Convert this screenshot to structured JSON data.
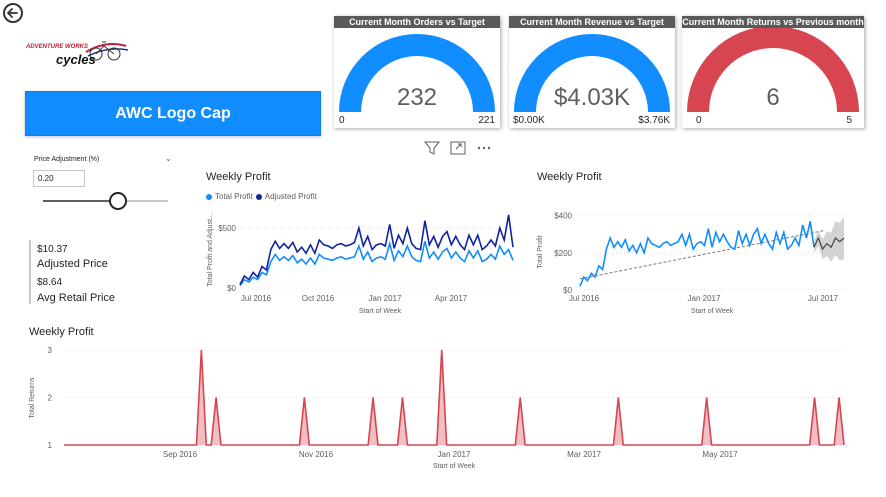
{
  "report": {
    "logo_text_top": "ADVENTURE WORKS",
    "logo_text_bottom": "cycles",
    "title_button": "AWC Logo Cap"
  },
  "gauges": [
    {
      "title": "Current Month Orders vs Target",
      "value": "232",
      "min": "0",
      "max": "221",
      "fraction": 1.0,
      "color": "#118DFF"
    },
    {
      "title": "Current Month Revenue vs Target",
      "value": "$4.03K",
      "min": "$0.00K",
      "max": "$3.76K",
      "fraction": 1.0,
      "color": "#118DFF"
    },
    {
      "title": "Current Month Returns vs Previous month",
      "value": "6",
      "min": "0",
      "max": "5",
      "fraction": 1.0,
      "color": "#D64550"
    }
  ],
  "slicer": {
    "label": "Price Adjustment (%)",
    "value": "0.20",
    "slider_fraction": 0.6
  },
  "cards": {
    "adjusted_price_value": "$10.37",
    "adjusted_price_label": "Adjusted Price",
    "avg_retail_value": "$8.64",
    "avg_retail_label": "Avg Retail Price"
  },
  "toolbar": {
    "filter_icon": "filter-icon",
    "focus_icon": "focus-mode-icon",
    "more_icon": "more-options-icon"
  },
  "chart_data": [
    {
      "type": "line",
      "title": "Weekly Profit",
      "xlabel": "Start of Week",
      "ylabel": "Total Profit and Adjust...",
      "x_ticks": [
        "Jul 2016",
        "Oct 2016",
        "Jan 2017",
        "Apr 2017"
      ],
      "y_ticks": [
        "$0",
        "$500"
      ],
      "ylim": [
        0,
        650
      ],
      "legend_position": "top-left",
      "series": [
        {
          "name": "Total Profit",
          "color": "#118DFF",
          "values": [
            20,
            70,
            50,
            90,
            70,
            130,
            110,
            220,
            280,
            230,
            260,
            230,
            270,
            210,
            240,
            200,
            250,
            200,
            280,
            250,
            240,
            230,
            250,
            260,
            240,
            250,
            260,
            350,
            240,
            300,
            220,
            250,
            260,
            240,
            370,
            230,
            310,
            260,
            350,
            260,
            230,
            220,
            390,
            250,
            300,
            240,
            300,
            330,
            250,
            300,
            250,
            220,
            310,
            250,
            310,
            220,
            240,
            280,
            240,
            350,
            280,
            320,
            230
          ]
        },
        {
          "name": "Adjusted Profit",
          "color": "#12239E",
          "values": [
            30,
            100,
            70,
            130,
            90,
            180,
            150,
            320,
            390,
            330,
            370,
            330,
            380,
            300,
            340,
            290,
            360,
            290,
            400,
            360,
            350,
            330,
            360,
            370,
            350,
            360,
            380,
            500,
            350,
            430,
            320,
            360,
            370,
            350,
            530,
            330,
            440,
            370,
            500,
            370,
            330,
            320,
            560,
            360,
            430,
            340,
            430,
            470,
            360,
            430,
            360,
            320,
            440,
            360,
            440,
            320,
            350,
            400,
            350,
            500,
            400,
            610,
            340
          ]
        }
      ]
    },
    {
      "type": "line",
      "title": "Weekly Profit",
      "xlabel": "Start of Week",
      "ylabel": "Total Profit",
      "x_ticks": [
        "Jul 2016",
        "Jan 2017",
        "Jul 2017"
      ],
      "y_ticks": [
        "$0",
        "$200",
        "$400"
      ],
      "ylim": [
        0,
        420
      ],
      "series": [
        {
          "name": "Total Profit",
          "color": "#118DFF",
          "values": [
            20,
            70,
            50,
            90,
            70,
            130,
            110,
            220,
            280,
            230,
            260,
            230,
            270,
            210,
            240,
            200,
            250,
            200,
            280,
            250,
            240,
            230,
            250,
            260,
            240,
            250,
            260,
            300,
            240,
            300,
            220,
            250,
            260,
            240,
            330,
            230,
            310,
            260,
            300,
            260,
            230,
            220,
            320,
            250,
            300,
            240,
            300,
            330,
            250,
            300,
            250,
            220,
            310,
            250,
            310,
            220,
            240,
            280,
            240,
            350,
            280,
            370,
            230
          ]
        },
        {
          "name": "Forecast",
          "color": "#444444",
          "values": [
            230,
            280,
            220,
            250,
            230,
            280,
            260,
            280
          ]
        }
      ]
    },
    {
      "type": "area",
      "title": "Weekly Profit",
      "xlabel": "Start of Week",
      "ylabel": "Total Returns",
      "x_ticks": [
        "Sep 2016",
        "Nov 2016",
        "Jan 2017",
        "Mar 2017",
        "May 2017"
      ],
      "y_ticks": [
        "1",
        "2",
        "3"
      ],
      "ylim": [
        1,
        3
      ],
      "series": [
        {
          "name": "Total Returns",
          "color": "#D64550",
          "values": [
            1,
            1,
            1,
            1,
            1,
            1,
            1,
            1,
            1,
            1,
            1,
            1,
            1,
            1,
            1,
            1,
            1,
            1,
            1,
            1,
            1,
            1,
            1,
            1,
            1,
            1,
            1,
            1,
            3,
            1,
            1,
            2,
            1,
            1,
            1,
            1,
            1,
            1,
            1,
            1,
            1,
            1,
            1,
            1,
            1,
            1,
            1,
            1,
            1,
            2,
            1,
            1,
            1,
            1,
            1,
            1,
            1,
            1,
            1,
            1,
            1,
            1,
            1,
            2,
            1,
            1,
            1,
            1,
            1,
            2,
            1,
            1,
            1,
            1,
            1,
            1,
            1,
            3,
            1,
            1,
            1,
            1,
            1,
            1,
            1,
            1,
            1,
            1,
            1,
            1,
            1,
            1,
            1,
            2,
            1,
            1,
            1,
            1,
            1,
            1,
            1,
            1,
            1,
            1,
            1,
            1,
            1,
            1,
            1,
            1,
            1,
            1,
            1,
            2,
            1,
            1,
            1,
            1,
            1,
            1,
            1,
            1,
            1,
            1,
            1,
            1,
            1,
            1,
            1,
            1,
            1,
            2,
            1,
            1,
            1,
            1,
            1,
            1,
            1,
            1,
            1,
            1,
            1,
            1,
            1,
            1,
            1,
            1,
            1,
            1,
            1,
            1,
            1,
            2,
            1,
            1,
            1,
            1,
            2,
            1
          ]
        }
      ]
    }
  ]
}
